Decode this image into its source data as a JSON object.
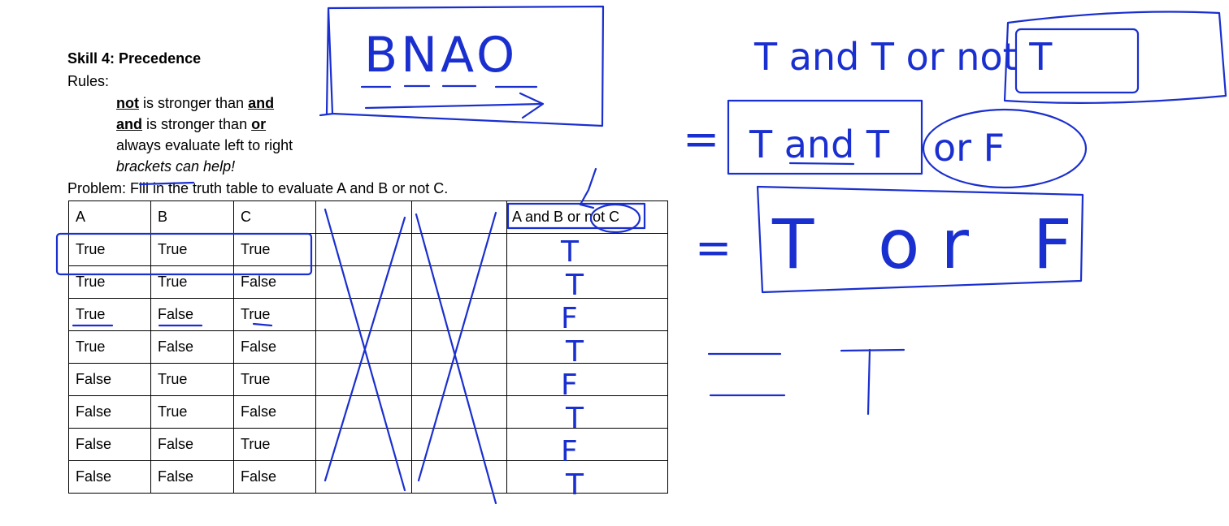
{
  "skill_title": "Skill 4: Precedence",
  "rules_label": "Rules:",
  "rules": [
    {
      "kw": "not",
      "rest": " is stronger than ",
      "kw2": "and"
    },
    {
      "kw": "and",
      "rest": " is stronger than ",
      "kw2": "or"
    },
    {
      "text": "always evaluate left to right"
    },
    {
      "text": "brackets can help!"
    }
  ],
  "problem": "Problem:  Fill in the truth table to evaluate A and B or not C.",
  "table": {
    "headers": [
      "A",
      "B",
      "C",
      "",
      "",
      "A and B or not C"
    ],
    "rows": [
      [
        "True",
        "True",
        "True"
      ],
      [
        "True",
        "True",
        "False"
      ],
      [
        "True",
        "False",
        "True"
      ],
      [
        "True",
        "False",
        "False"
      ],
      [
        "False",
        "True",
        "True"
      ],
      [
        "False",
        "True",
        "False"
      ],
      [
        "False",
        "False",
        "True"
      ],
      [
        "False",
        "False",
        "False"
      ]
    ],
    "handwritten_answers": [
      "T",
      "T",
      "F",
      "T",
      "F",
      "T",
      "F",
      "T"
    ]
  },
  "handwriting": {
    "mnemonic": "BNAO",
    "step1": "T and T or not T",
    "step2_prefix": "=",
    "step2_inner": "T and T",
    "step2_rest": "or F",
    "step3_prefix": "=",
    "step3": "T or F",
    "step4_prefix": "=",
    "step4": "T"
  },
  "ink_color": "#1a2fcf"
}
